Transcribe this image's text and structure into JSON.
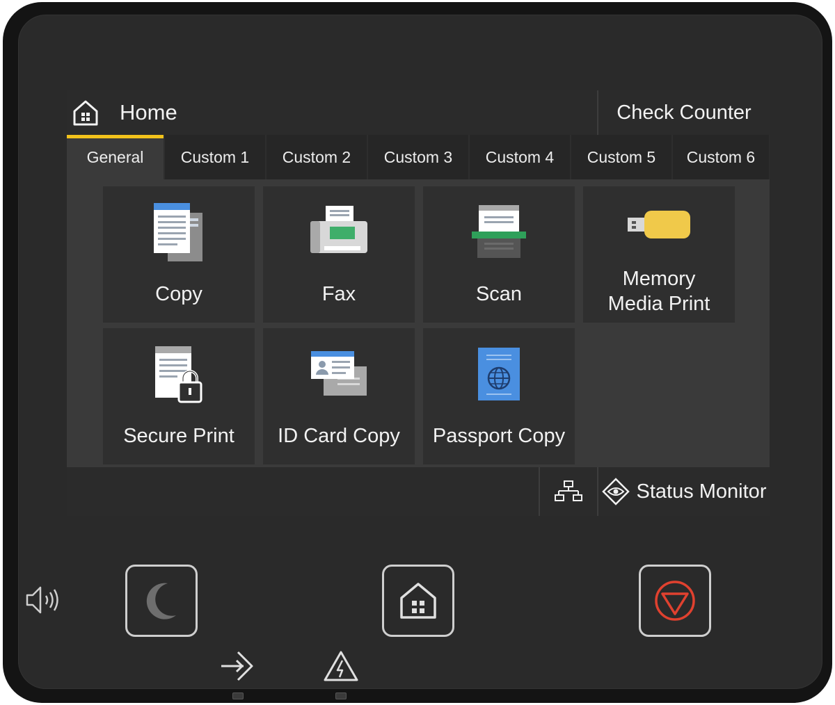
{
  "header": {
    "home_label": "Home",
    "check_counter_label": "Check Counter"
  },
  "tabs": [
    {
      "label": "General",
      "active": true
    },
    {
      "label": "Custom 1",
      "active": false
    },
    {
      "label": "Custom 2",
      "active": false
    },
    {
      "label": "Custom 3",
      "active": false
    },
    {
      "label": "Custom 4",
      "active": false
    },
    {
      "label": "Custom 5",
      "active": false
    },
    {
      "label": "Custom 6",
      "active": false
    }
  ],
  "tiles": [
    {
      "label": "Copy",
      "icon": "copy-icon"
    },
    {
      "label": "Fax",
      "icon": "fax-icon"
    },
    {
      "label": "Scan",
      "icon": "scan-icon"
    },
    {
      "label_line1": "Memory",
      "label_line2": "Media Print",
      "icon": "usb-memory-icon"
    },
    {
      "label": "Secure Print",
      "icon": "secure-print-icon"
    },
    {
      "label": "ID Card Copy",
      "icon": "id-card-copy-icon"
    },
    {
      "label": "Passport Copy",
      "icon": "passport-icon"
    }
  ],
  "footer": {
    "network_icon": "network-icon",
    "status_monitor_label": "Status Monitor"
  },
  "hardware": {
    "volume_icon": "volume-icon",
    "sleep_icon": "moon-icon",
    "home_icon": "home-icon",
    "stop_icon": "stop-icon",
    "job_indicator_icon": "job-login-icon",
    "error_indicator_icon": "warning-icon"
  },
  "colors": {
    "active_tab_accent": "#f2c21b",
    "stop_red": "#e0412f",
    "scan_green": "#2fa05a",
    "usb_yellow": "#f0c94a",
    "passport_blue": "#4a8fe0"
  }
}
